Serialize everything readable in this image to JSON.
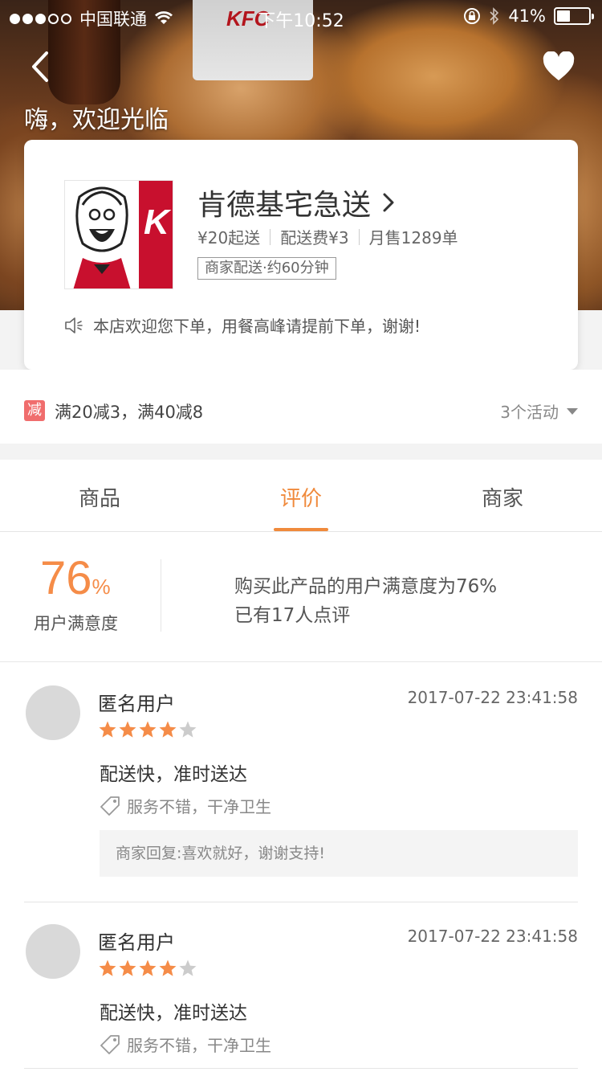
{
  "status_bar": {
    "carrier": "中国联通",
    "time": "下午10:52",
    "battery": "41%",
    "battery_level": 0.41
  },
  "hero": {
    "welcome": "嗨，欢迎光临",
    "cup_logo_text": "KFC"
  },
  "store": {
    "name": "肯德基宅急送",
    "min_order": "¥20起送",
    "delivery_fee": "配送费¥3",
    "monthly_sales": "月售1289单",
    "delivery_tag": "商家配送·约60分钟",
    "notice": "本店欢迎您下单，用餐高峰请提前下单，谢谢!",
    "logo_text": "K"
  },
  "promo": {
    "tag": "减",
    "text": "满20减3，满40减8",
    "more": "3个活动"
  },
  "tabs": [
    {
      "label": "商品",
      "active": false
    },
    {
      "label": "评价",
      "active": true
    },
    {
      "label": "商家",
      "active": false
    }
  ],
  "summary": {
    "percent": "76",
    "percent_sign": "%",
    "label": "用户满意度",
    "line1": "购买此产品的用户满意度为76%",
    "line2": "已有17人点评"
  },
  "reviews": [
    {
      "user": "匿名用户",
      "time": "2017-07-22 23:41:58",
      "rating": 4,
      "max_rating": 5,
      "text": "配送快，准时送达",
      "tags": "服务不错，干净卫生",
      "reply": "商家回复:喜欢就好，谢谢支持!"
    },
    {
      "user": "匿名用户",
      "time": "2017-07-22 23:41:58",
      "rating": 4,
      "max_rating": 5,
      "text": "配送快，准时送达",
      "tags": "服务不错，干净卫生"
    }
  ],
  "colors": {
    "accent": "#f08a3c",
    "star_on": "#f58c48",
    "star_off": "#cccccc",
    "promo_tag": "#f06d6d"
  }
}
